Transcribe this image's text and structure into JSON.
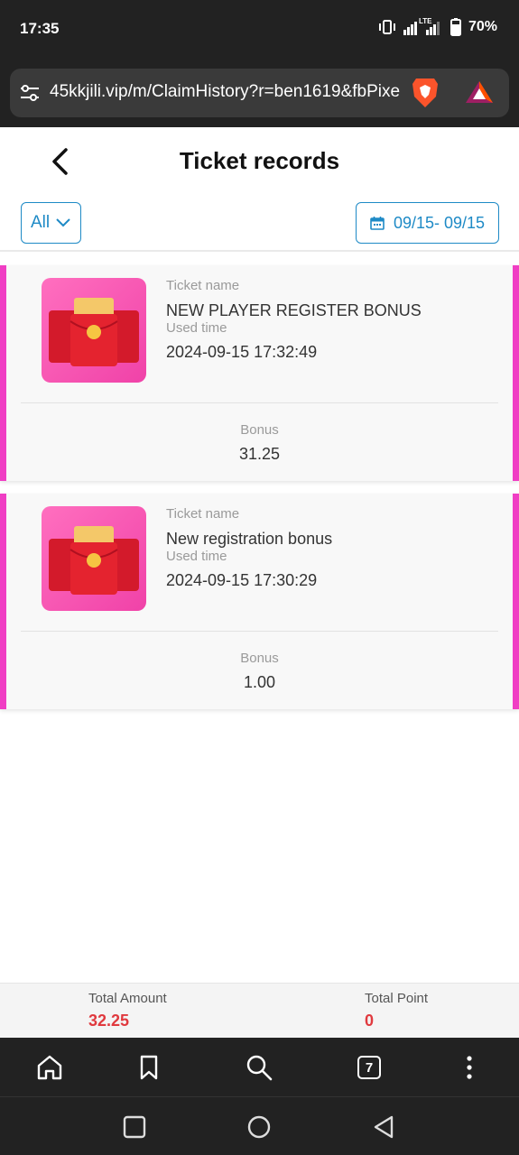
{
  "status_bar": {
    "time": "17:35",
    "network": "LTE",
    "battery": "70%"
  },
  "browser": {
    "url": "45kkjili.vip/m/ClaimHistory?r=ben1619&fbPixe",
    "tab_count": "7",
    "icons": [
      "tune-icon",
      "brave-icon",
      "bat-icon",
      "home-icon",
      "bookmark-icon",
      "search-icon",
      "more-icon"
    ]
  },
  "header": {
    "title": "Ticket records"
  },
  "filters": {
    "type_selected": "All",
    "date_range": "09/15- 09/15"
  },
  "labels": {
    "ticket_name": "Ticket name",
    "used_time": "Used time",
    "bonus": "Bonus"
  },
  "records": [
    {
      "ticket_name": "NEW PLAYER REGISTER BONUS",
      "used_time": "2024-09-15 17:32:49",
      "bonus": "31.25"
    },
    {
      "ticket_name": "New registration bonus",
      "used_time": "2024-09-15 17:30:29",
      "bonus": "1.00"
    }
  ],
  "totals": {
    "amount_label": "Total Amount",
    "amount_value": "32.25",
    "point_label": "Total Point",
    "point_value": "0"
  },
  "colors": {
    "accent_blue": "#1e8ac6",
    "card_border_pink": "#f03ec4",
    "total_red": "#e0393e",
    "chrome_dark": "#222222"
  }
}
